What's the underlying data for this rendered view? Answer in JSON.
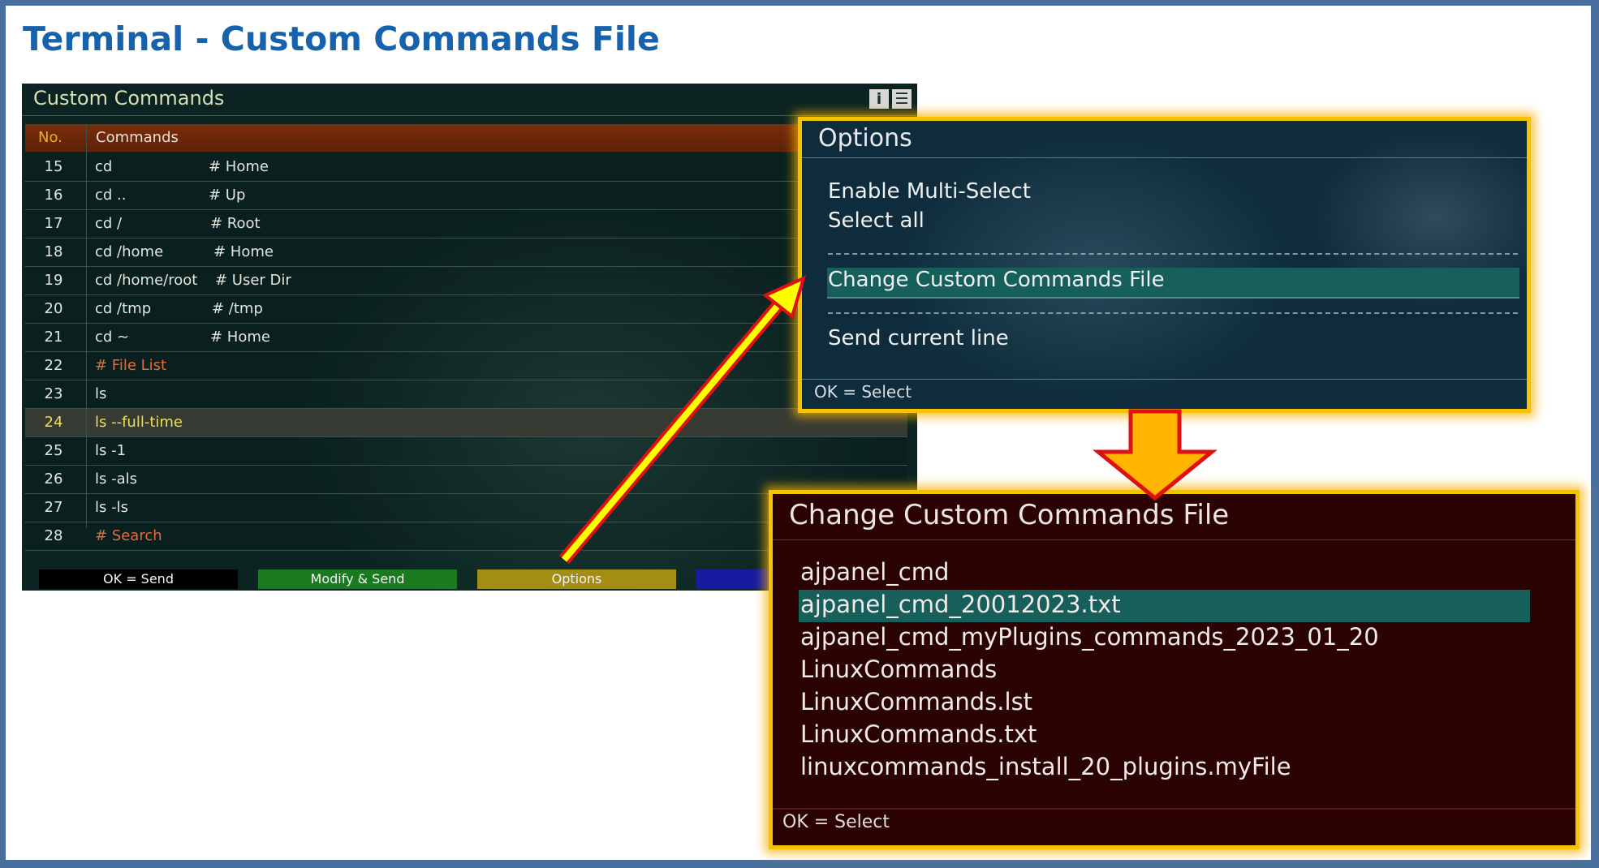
{
  "page": {
    "title": "Terminal - Custom Commands File"
  },
  "custom_commands": {
    "title": "Custom Commands",
    "icons": [
      "info-icon",
      "menu-icon"
    ],
    "info_glyph": "i",
    "menu_glyph": "☰",
    "columns": {
      "no": "No.",
      "commands": "Commands"
    },
    "rows": [
      {
        "no": "15",
        "command": "cd",
        "note": "# Home"
      },
      {
        "no": "16",
        "command": "cd ..",
        "note": "# Up"
      },
      {
        "no": "17",
        "command": "cd /",
        "note": "# Root"
      },
      {
        "no": "18",
        "command": "cd /home",
        "note": "# Home"
      },
      {
        "no": "19",
        "command": "cd /home/root",
        "note": "# User Dir"
      },
      {
        "no": "20",
        "command": "cd /tmp",
        "note": "# /tmp"
      },
      {
        "no": "21",
        "command": "cd ~",
        "note": "# Home"
      },
      {
        "no": "22",
        "command": "# File List",
        "note": ""
      },
      {
        "no": "23",
        "command": "ls",
        "note": ""
      },
      {
        "no": "24",
        "command": "ls --full-time",
        "note": ""
      },
      {
        "no": "25",
        "command": "ls -1",
        "note": ""
      },
      {
        "no": "26",
        "command": "ls -als",
        "note": ""
      },
      {
        "no": "27",
        "command": "ls -ls",
        "note": ""
      },
      {
        "no": "28",
        "command": "# Search",
        "note": ""
      }
    ],
    "selected_row": "24",
    "footer": {
      "ok": "OK = Send",
      "green": "Modify & Send",
      "yellow": "Options",
      "blue": ""
    },
    "colors": {
      "green_key": "#197a1f",
      "yellow_key": "#a38d13",
      "blue_key": "#171ba0",
      "red_key": "#000000"
    }
  },
  "options_popup": {
    "title": "Options",
    "items": [
      "Enable Multi-Select",
      "Select all",
      "Change Custom Commands File",
      "Send current line"
    ],
    "selected": "Change Custom Commands File",
    "footer": "OK = Select"
  },
  "file_popup": {
    "title": "Change Custom Commands File",
    "files": [
      "ajpanel_cmd",
      "ajpanel_cmd_20012023.txt",
      "ajpanel_cmd_myPlugins_commands_2023_01_20",
      "LinuxCommands",
      "LinuxCommands.lst",
      "LinuxCommands.txt",
      "linuxcommands_install_20_plugins.myFile"
    ],
    "selected": "ajpanel_cmd_20012023.txt",
    "footer": "OK = Select"
  },
  "annotation": {
    "arrow_color": "#ffff00",
    "arrow_outline": "#dd1111",
    "down_arrow_fill": "#ffb400"
  }
}
